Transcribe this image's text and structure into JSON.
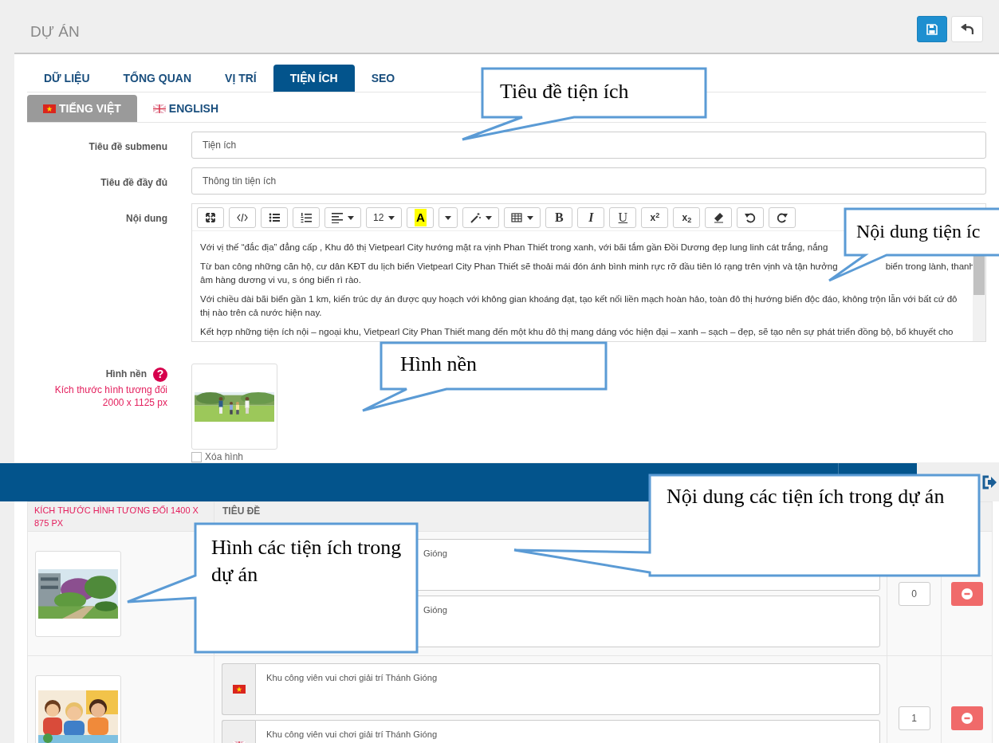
{
  "header": {
    "title": "DỰ ÁN"
  },
  "tabs": [
    {
      "label": "DỮ LIỆU",
      "selected": false
    },
    {
      "label": "TỔNG QUAN",
      "selected": false
    },
    {
      "label": "VỊ TRÍ",
      "selected": false
    },
    {
      "label": "TIỆN ÍCH",
      "selected": true
    },
    {
      "label": "SEO",
      "selected": false
    }
  ],
  "language_tabs": [
    {
      "label": "TIẾNG VIỆT",
      "kind": "vietnamese",
      "selected": true
    },
    {
      "label": "ENGLISH",
      "kind": "english",
      "selected": false
    }
  ],
  "fields": [
    {
      "label": "Tiêu đề submenu",
      "value": "Tiện ích"
    },
    {
      "label": "Tiêu đề đầy đủ",
      "value": "Thông tin tiện ích"
    }
  ],
  "editor": {
    "label": "Nội dung",
    "toolbar": {
      "font_size": "12",
      "text_color": "A",
      "bold": "B",
      "italic": "I",
      "underline": "U",
      "superscript": "x$^{2}$",
      "subscript": "x$_{2}$"
    },
    "paragraphs": [
      [
        [
          "Với vị thế “đắc địa” đẳng cấp , Khu đô thị Vietpearl City hướng mặt ra vịnh Phan Thiết trong xanh, với bãi tắm gần Đồi Dương đẹp lung linh cát trắng, nắng"
        ]
      ],
      [
        [
          "Từ ban công những căn hộ, cư dân KĐT du lịch biển Vietpearl City Phan Thiết sẽ thoải mái đón ánh bình minh rực rỡ đầu tiên ló rạng trên vịnh và tận hưởng",
          "biển trong lành, thanh"
        ],
        [
          "âm hàng dương vi vu, s óng biển rì rào."
        ]
      ],
      [
        [
          "Với chiều dài bãi biển gần 1 km, kiến trúc dự án được quy hoạch với không gian khoáng đạt, tạo kết nối liền mạch hoàn hảo, toàn đô thị hướng biển độc đáo, không trộn lẫn với bất cứ đô thị nào trên cả nước hiện nay."
        ]
      ],
      [
        [
          "Kết hợp những tiện ích nội – ngoại khu, Vietpearl City Phan Thiết mang đến một khu đô thị mang dáng vóc hiện đại – xanh – sạch – đẹp, sẽ tạo nên sự phát triển đồng bộ, bổ khuyết cho"
        ]
      ]
    ]
  },
  "background": {
    "label": "Hình nền",
    "help": "?",
    "note": "Kích thước hình tương đối 2000 x 1125 px",
    "delete_option": {
      "label": "Xóa hình",
      "checked": false
    }
  },
  "amenities": {
    "columns": [
      {
        "text": "KÍCH THƯỚC HÌNH TƯƠNG ĐỐI 1400 X 875 PX",
        "kind": "hint"
      },
      {
        "text": "TIÊU ĐỀ",
        "kind": "heading"
      }
    ],
    "rows": [
      {
        "titles": [
          {
            "text": "Gióng"
          },
          {
            "text": "Gióng"
          }
        ],
        "order": "0"
      },
      {
        "titles": [
          {
            "kind": "vietnamese",
            "text": "Khu công viên vui chơi giải trí Thánh Gióng"
          },
          {
            "kind": "english",
            "text": "Khu công viên vui chơi giải trí Thánh Gióng"
          }
        ],
        "order": "1"
      }
    ]
  },
  "callouts": [
    {
      "text": "Tiêu đề tiện ích"
    },
    {
      "text": "Nội dung tiện íc"
    },
    {
      "text": "Hình nền"
    },
    {
      "text": "Nội dung các tiện ích trong dự án"
    },
    {
      "text": "Hình các tiện ích trong dự án"
    }
  ]
}
